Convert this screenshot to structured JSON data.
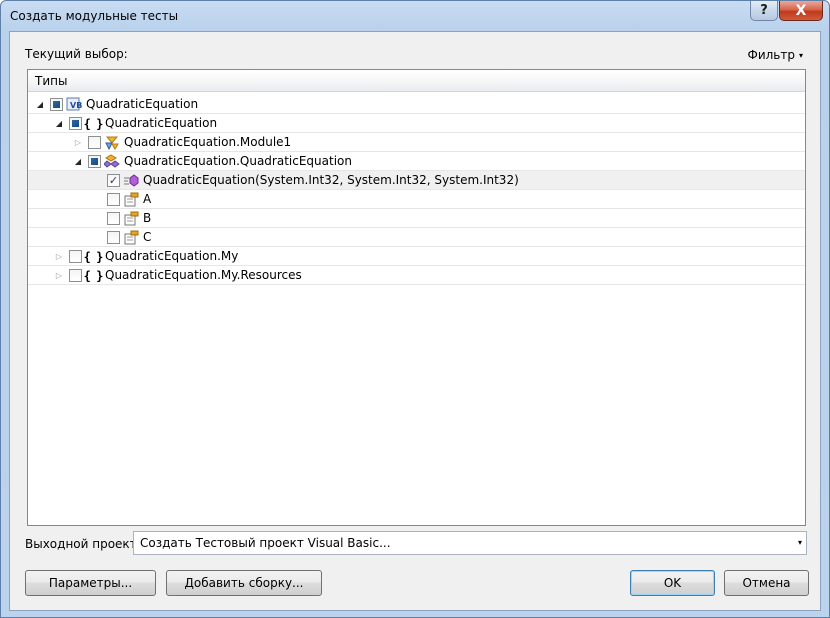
{
  "window": {
    "title": "Создать модульные тесты",
    "help_label": "?",
    "close_label": "X"
  },
  "current_selection_label": "Текущий выбор:",
  "filter": {
    "label": "Фильтр",
    "arrow": "▾"
  },
  "tree": {
    "header": "Типы",
    "rows": [
      {
        "text": "QuadraticEquation",
        "state": "partial",
        "expander": "open",
        "icon": "vb-project-icon"
      },
      {
        "text": "QuadraticEquation",
        "state": "partial",
        "expander": "open",
        "icon": "namespace-icon",
        "icon_text": "{ }"
      },
      {
        "text": "QuadraticEquation.Module1",
        "state": "unchecked",
        "expander": "closed",
        "icon": "module-icon"
      },
      {
        "text": "QuadraticEquation.QuadraticEquation",
        "state": "partial",
        "expander": "open",
        "icon": "class-icon"
      },
      {
        "text": "QuadraticEquation(System.Int32, System.Int32, System.Int32)",
        "state": "checked",
        "icon": "method-icon"
      },
      {
        "text": "A",
        "state": "unchecked",
        "icon": "property-icon"
      },
      {
        "text": "B",
        "state": "unchecked",
        "icon": "property-icon"
      },
      {
        "text": "C",
        "state": "unchecked",
        "icon": "property-icon"
      },
      {
        "text": "QuadraticEquation.My",
        "state": "unchecked",
        "expander": "closed",
        "icon": "namespace-icon",
        "icon_text": "{ }"
      },
      {
        "text": "QuadraticEquation.My.Resources",
        "state": "unchecked",
        "expander": "closed",
        "icon": "namespace-icon",
        "icon_text": "{ }"
      }
    ],
    "check_mark": "✓"
  },
  "output": {
    "label": "Выходной проект:",
    "value": "Создать Тестовый проект Visual Basic...",
    "arrow": "▾"
  },
  "buttons": {
    "params": "Параметры...",
    "add_assembly": "Добавить сборку...",
    "ok": "OK",
    "cancel": "Отмена"
  },
  "expander_glyphs": {
    "open": "◢",
    "closed": "▷"
  }
}
